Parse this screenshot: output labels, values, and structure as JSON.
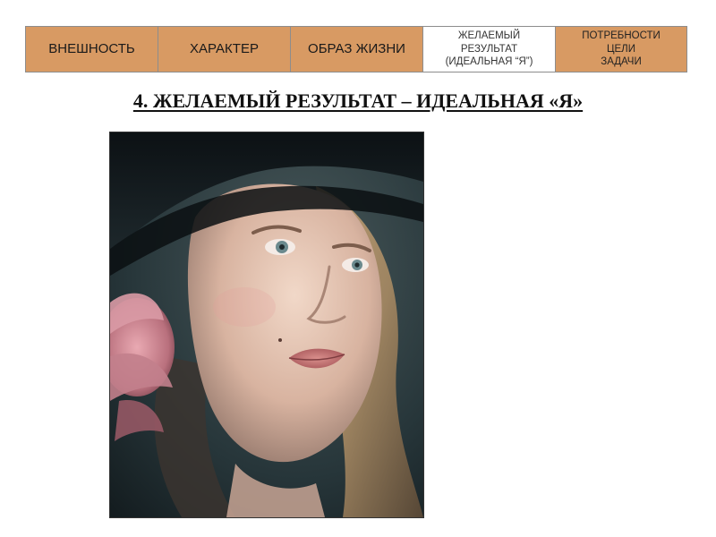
{
  "nav": {
    "items": [
      {
        "label": "ВНЕШНОСТЬ"
      },
      {
        "label": "ХАРАКТЕР"
      },
      {
        "label": "ОБРАЗ ЖИЗНИ"
      },
      {
        "label": "ЖЕЛАЕМЫЙ\nРЕЗУЛЬТАТ\n(ИДЕАЛЬНАЯ “Я”)"
      },
      {
        "label": "ПОТРЕБНОСТИ\nЦЕЛИ\nЗАДАЧИ"
      }
    ],
    "active_index": 3
  },
  "main": {
    "title": "4. ЖЕЛАЕМЫЙ РЕЗУЛЬТАТ – ИДЕАЛЬНАЯ «Я»"
  },
  "colors": {
    "nav_background": "#d89a63",
    "nav_active_background": "#ffffff",
    "nav_border": "#8d8d8d"
  }
}
